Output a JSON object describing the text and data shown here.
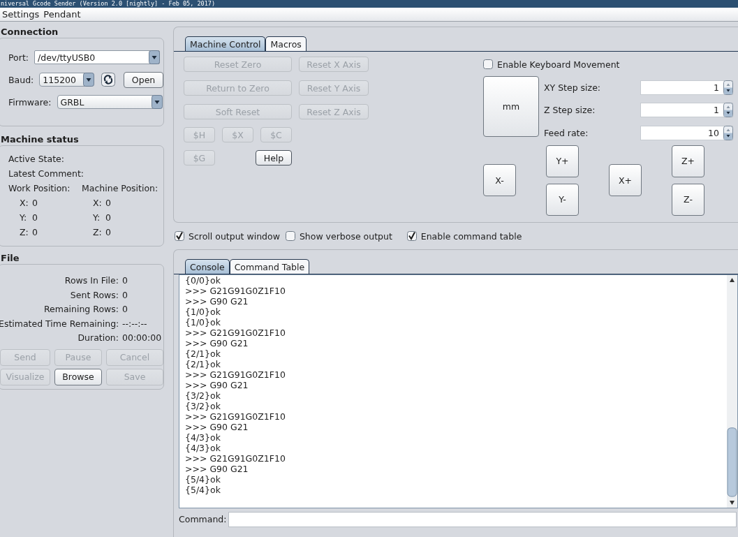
{
  "window": {
    "title": "niversal Gcode Sender (Version 2.0 [nightly] - Feb 05, 2017)"
  },
  "menu": [
    "Settings",
    "Pendant"
  ],
  "connection": {
    "heading": "Connection",
    "port_label": "Port:",
    "port": "/dev/ttyUSB0",
    "baud_label": "Baud:",
    "baud": "115200",
    "open_button": "Open",
    "firmware_label": "Firmware:",
    "firmware": "GRBL"
  },
  "machine_status": {
    "heading": "Machine status",
    "active_state_label": "Active State:",
    "latest_comment_label": "Latest Comment:",
    "work_position": {
      "label": "Work Position:",
      "axes": [
        {
          "axis": "X:",
          "value": "0"
        },
        {
          "axis": "Y:",
          "value": "0"
        },
        {
          "axis": "Z:",
          "value": "0"
        }
      ]
    },
    "machine_position": {
      "label": "Machine Position:",
      "axes": [
        {
          "axis": "X:",
          "value": "0"
        },
        {
          "axis": "Y:",
          "value": "0"
        },
        {
          "axis": "Z:",
          "value": "0"
        }
      ]
    }
  },
  "file": {
    "heading": "File",
    "stats": [
      {
        "label": "Rows In File:",
        "value": "0"
      },
      {
        "label": "Sent Rows:",
        "value": "0"
      },
      {
        "label": "Remaining Rows:",
        "value": "0"
      },
      {
        "label": "Estimated Time Remaining:",
        "value": "--:--:--"
      },
      {
        "label": "Duration:",
        "value": "00:00:00"
      }
    ],
    "buttons": [
      {
        "label": "Send",
        "disabled": true
      },
      {
        "label": "Pause",
        "disabled": true
      },
      {
        "label": "Cancel",
        "disabled": true
      },
      {
        "label": "Visualize",
        "disabled": true
      },
      {
        "label": "Browse",
        "disabled": false
      },
      {
        "label": "Save",
        "disabled": true
      }
    ]
  },
  "control_tabs": [
    {
      "label": "Machine Control",
      "selected": true
    },
    {
      "label": "Macros",
      "selected": false
    }
  ],
  "wide_buttons": [
    {
      "label": "Reset Zero",
      "disabled": true
    },
    {
      "label": "Return to Zero",
      "disabled": true
    },
    {
      "label": "Soft Reset",
      "disabled": true
    }
  ],
  "axis_buttons": [
    {
      "label": "Reset X Axis",
      "disabled": true
    },
    {
      "label": "Reset Y Axis",
      "disabled": true
    },
    {
      "label": "Reset Z Axis",
      "disabled": true
    }
  ],
  "dollar_buttons": [
    {
      "label": "$H",
      "disabled": true
    },
    {
      "label": "$X",
      "disabled": true
    },
    {
      "label": "$C",
      "disabled": true
    },
    {
      "label": "$G",
      "disabled": true
    }
  ],
  "help_button": {
    "label": "Help",
    "disabled": false
  },
  "keyboard_movement": {
    "label": "Enable Keyboard Movement",
    "checked": false
  },
  "units_button": "mm",
  "step_fields": [
    {
      "label": "XY Step size:",
      "value": "1"
    },
    {
      "label": "Z Step size:",
      "value": "1"
    },
    {
      "label": "Feed rate:",
      "value": "10"
    }
  ],
  "jog_buttons": [
    "Y+",
    "Z+",
    "X-",
    "X+",
    "Y-",
    "Z-"
  ],
  "output_options": [
    {
      "label": "Scroll output window",
      "checked": true
    },
    {
      "label": "Show verbose output",
      "checked": false
    },
    {
      "label": "Enable command table",
      "checked": true
    }
  ],
  "console_tabs": [
    {
      "label": "Console",
      "selected": true
    },
    {
      "label": "Command Table",
      "selected": false
    }
  ],
  "console_lines": [
    "{0/0}ok",
    ">>> G21G91G0Z1F10",
    ">>> G90 G21",
    "{1/0}ok",
    "{1/0}ok",
    ">>> G21G91G0Z1F10",
    ">>> G90 G21",
    "{2/1}ok",
    "{2/1}ok",
    ">>> G21G91G0Z1F10",
    ">>> G90 G21",
    "{3/2}ok",
    "{3/2}ok",
    ">>> G21G91G0Z1F10",
    ">>> G90 G21",
    "{4/3}ok",
    "{4/3}ok",
    ">>> G21G91G0Z1F10",
    ">>> G90 G21",
    "{5/4}ok",
    "{5/4}ok"
  ],
  "command": {
    "label": "Command:"
  }
}
